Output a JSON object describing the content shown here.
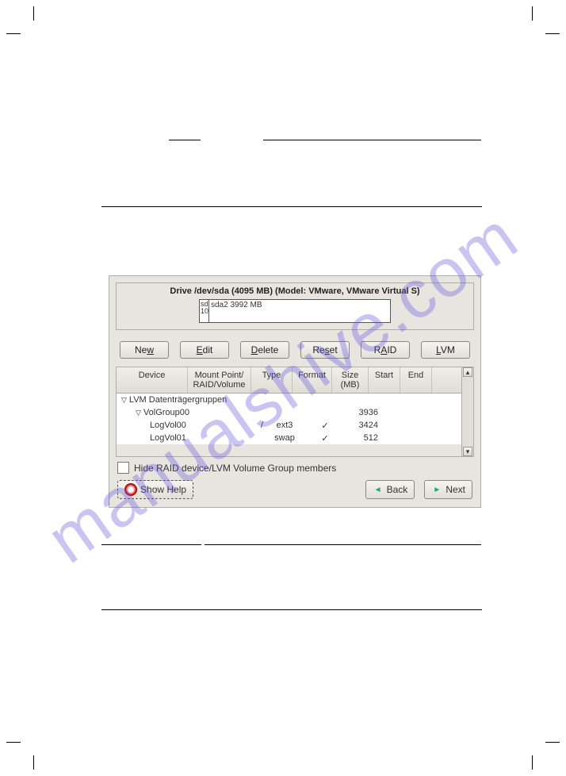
{
  "watermark": "manualshive.com",
  "dialog": {
    "drive_title": "Drive /dev/sda (4095 MB) (Model: VMware, VMware Virtual S)",
    "slice1_label": "sd\n10",
    "slice2_label": "sda2\n3992 MB",
    "buttons": {
      "new": "New",
      "edit": "Edit",
      "delete": "Delete",
      "reset": "Reset",
      "raid": "RAID",
      "lvm": "LVM"
    },
    "columns": {
      "device": "Device",
      "mountpoint": "Mount Point/\nRAID/Volume",
      "type": "Type",
      "format": "Format",
      "size": "Size\n(MB)",
      "start": "Start",
      "end": "End"
    },
    "rows": [
      {
        "device": "LVM Datenträgergruppen",
        "indent": 0,
        "tri": true,
        "mp": "",
        "type": "",
        "fmt": "",
        "size": "",
        "start": "",
        "end": ""
      },
      {
        "device": "VolGroup00",
        "indent": 1,
        "tri": true,
        "mp": "",
        "type": "",
        "fmt": "",
        "size": "3936",
        "start": "",
        "end": ""
      },
      {
        "device": "LogVol00",
        "indent": 2,
        "tri": false,
        "mp": "/",
        "type": "ext3",
        "fmt": "✓",
        "size": "3424",
        "start": "",
        "end": ""
      },
      {
        "device": "LogVol01",
        "indent": 2,
        "tri": false,
        "mp": "",
        "type": "swap",
        "fmt": "✓",
        "size": "512",
        "start": "",
        "end": ""
      }
    ],
    "hide_label": "Hide RAID device/LVM Volume Group members",
    "footer": {
      "help": "Show Help",
      "back": "Back",
      "next": "Next"
    }
  }
}
